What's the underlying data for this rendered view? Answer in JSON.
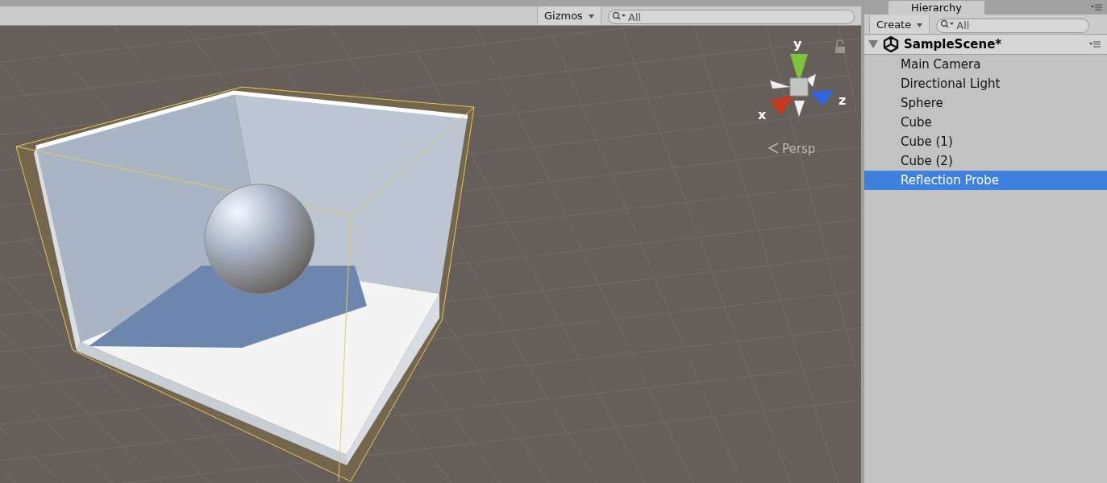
{
  "scene_view": {
    "gizmos_button": "Gizmos",
    "search": {
      "placeholder": "All"
    },
    "axis_labels": {
      "y": "y",
      "z": "z",
      "x": "x"
    },
    "projection_label": "Persp"
  },
  "hierarchy": {
    "tab": "Hierarchy",
    "create_button": "Create",
    "search": {
      "placeholder": "All"
    },
    "scene": {
      "name": "SampleScene*",
      "expanded": true,
      "children": [
        {
          "name": "Main Camera",
          "selected": false
        },
        {
          "name": "Directional Light",
          "selected": false
        },
        {
          "name": "Sphere",
          "selected": false
        },
        {
          "name": "Cube",
          "selected": false
        },
        {
          "name": "Cube (1)",
          "selected": false
        },
        {
          "name": "Cube (2)",
          "selected": false
        },
        {
          "name": "Reflection Probe",
          "selected": true
        }
      ]
    }
  }
}
